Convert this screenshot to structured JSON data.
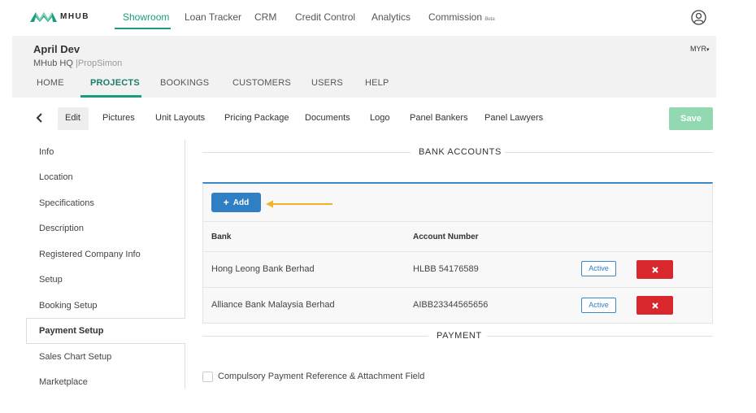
{
  "brand": {
    "name": "MHUB",
    "accent": "#1a9c7f"
  },
  "topnav": {
    "items": [
      {
        "label": "Showroom",
        "active": true
      },
      {
        "label": "Loan Tracker"
      },
      {
        "label": "CRM"
      },
      {
        "label": "Credit Control"
      },
      {
        "label": "Analytics"
      },
      {
        "label": "Commission"
      }
    ],
    "commission_badge": "Beta",
    "user_icon": "user-circle-icon"
  },
  "project": {
    "name": "April Dev",
    "org": "MHub HQ",
    "separator": "|",
    "user": "PropSimon",
    "currency": "MYR"
  },
  "project_tabs": [
    "HOME",
    "PROJECTS",
    "BOOKINGS",
    "CUSTOMERS",
    "USERS",
    "HELP"
  ],
  "project_tabs_active": "PROJECTS",
  "subtabs": [
    "Edit",
    "Pictures",
    "Unit Layouts",
    "Pricing Package",
    "Documents",
    "Logo",
    "Panel Bankers",
    "Panel Lawyers"
  ],
  "subtabs_active": "Edit",
  "save_label": "Save",
  "sidebar": {
    "items": [
      "Info",
      "Location",
      "Specifications",
      "Description",
      "Registered Company Info",
      "Setup",
      "Booking Setup",
      "Payment Setup",
      "Sales Chart Setup",
      "Marketplace"
    ],
    "active": "Payment Setup"
  },
  "bank_accounts": {
    "title": "BANK ACCOUNTS",
    "add_label": "Add",
    "columns": [
      "Bank",
      "Account Number"
    ],
    "rows": [
      {
        "bank": "Hong Leong Bank Berhad",
        "account": "HLBB 54176589",
        "status": "Active"
      },
      {
        "bank": "Alliance Bank Malaysia Berhad",
        "account": "AIBB23344565656",
        "status": "Active"
      }
    ]
  },
  "payment": {
    "title": "PAYMENT",
    "checkbox_label": "Compulsory Payment Reference & Attachment Field",
    "checked": false
  },
  "colors": {
    "add_button": "#2f7fc4",
    "delete_button": "#d9272e",
    "save_button": "#92d9b2",
    "arrow": "#f0b429"
  }
}
